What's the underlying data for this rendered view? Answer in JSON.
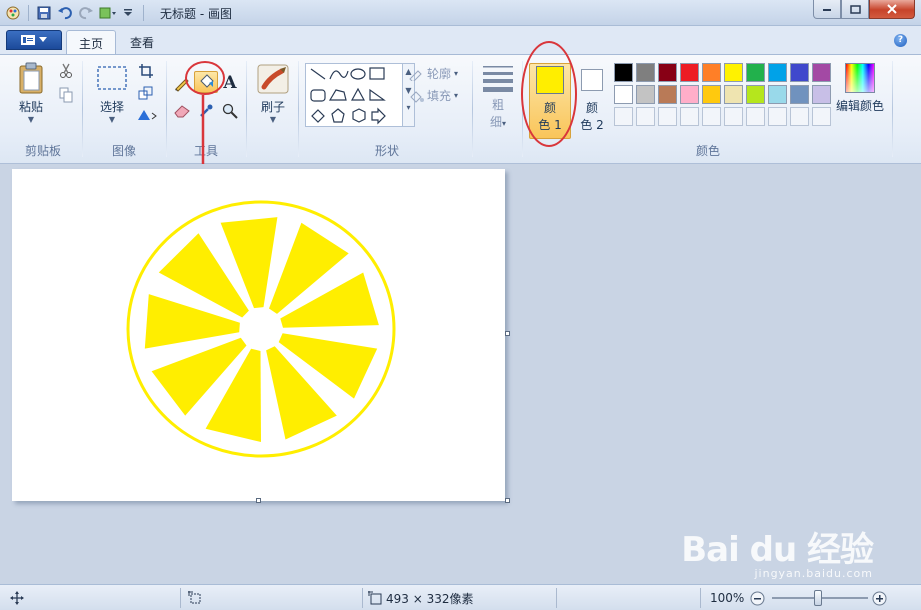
{
  "window": {
    "title": "无标题 - 画图",
    "colors": {
      "titlebar": "#c4d3e8",
      "close": "#c7432a"
    }
  },
  "tabs": [
    {
      "label": "主页",
      "active": true
    },
    {
      "label": "查看",
      "active": false
    }
  ],
  "ribbon": {
    "clipboard": {
      "label": "剪贴板",
      "paste_label": "粘贴"
    },
    "image": {
      "label": "图像",
      "select_label": "选择"
    },
    "tools": {
      "label": "工具"
    },
    "brushes": {
      "label": "刷子"
    },
    "shapes": {
      "label": "形状",
      "outline_label": "轮廓",
      "fill_label": "填充"
    },
    "size": {
      "label_line1": "粗",
      "label_line2": "细"
    },
    "colors": {
      "label": "颜色",
      "color1_line1": "颜",
      "color1_line2": "色 1",
      "color2_line1": "颜",
      "color2_line2": "色 2",
      "edit_colors_label": "编辑颜色",
      "color1_value": "#ffee00",
      "color2_value": "#ffffff",
      "palette_row1": [
        "#000000",
        "#7f7f7f",
        "#880015",
        "#ed1c24",
        "#ff7f27",
        "#fff200",
        "#22b14c",
        "#00a2e8",
        "#3f48cc",
        "#a349a4"
      ],
      "palette_row2": [
        "#ffffff",
        "#c3c3c3",
        "#b97a57",
        "#ffaec9",
        "#ffc90e",
        "#efe4b0",
        "#b5e61d",
        "#99d9ea",
        "#7092be",
        "#c8bfe7"
      ]
    }
  },
  "canvas": {
    "drawing": "yellow lemon slice",
    "fill_color": "#ffee00",
    "background": "#ffffff"
  },
  "statusbar": {
    "dimensions": "493 × 332像素",
    "zoom": "100%"
  },
  "watermark": {
    "main": "Bai du 经验",
    "sub": "jingyan.baidu.com"
  }
}
